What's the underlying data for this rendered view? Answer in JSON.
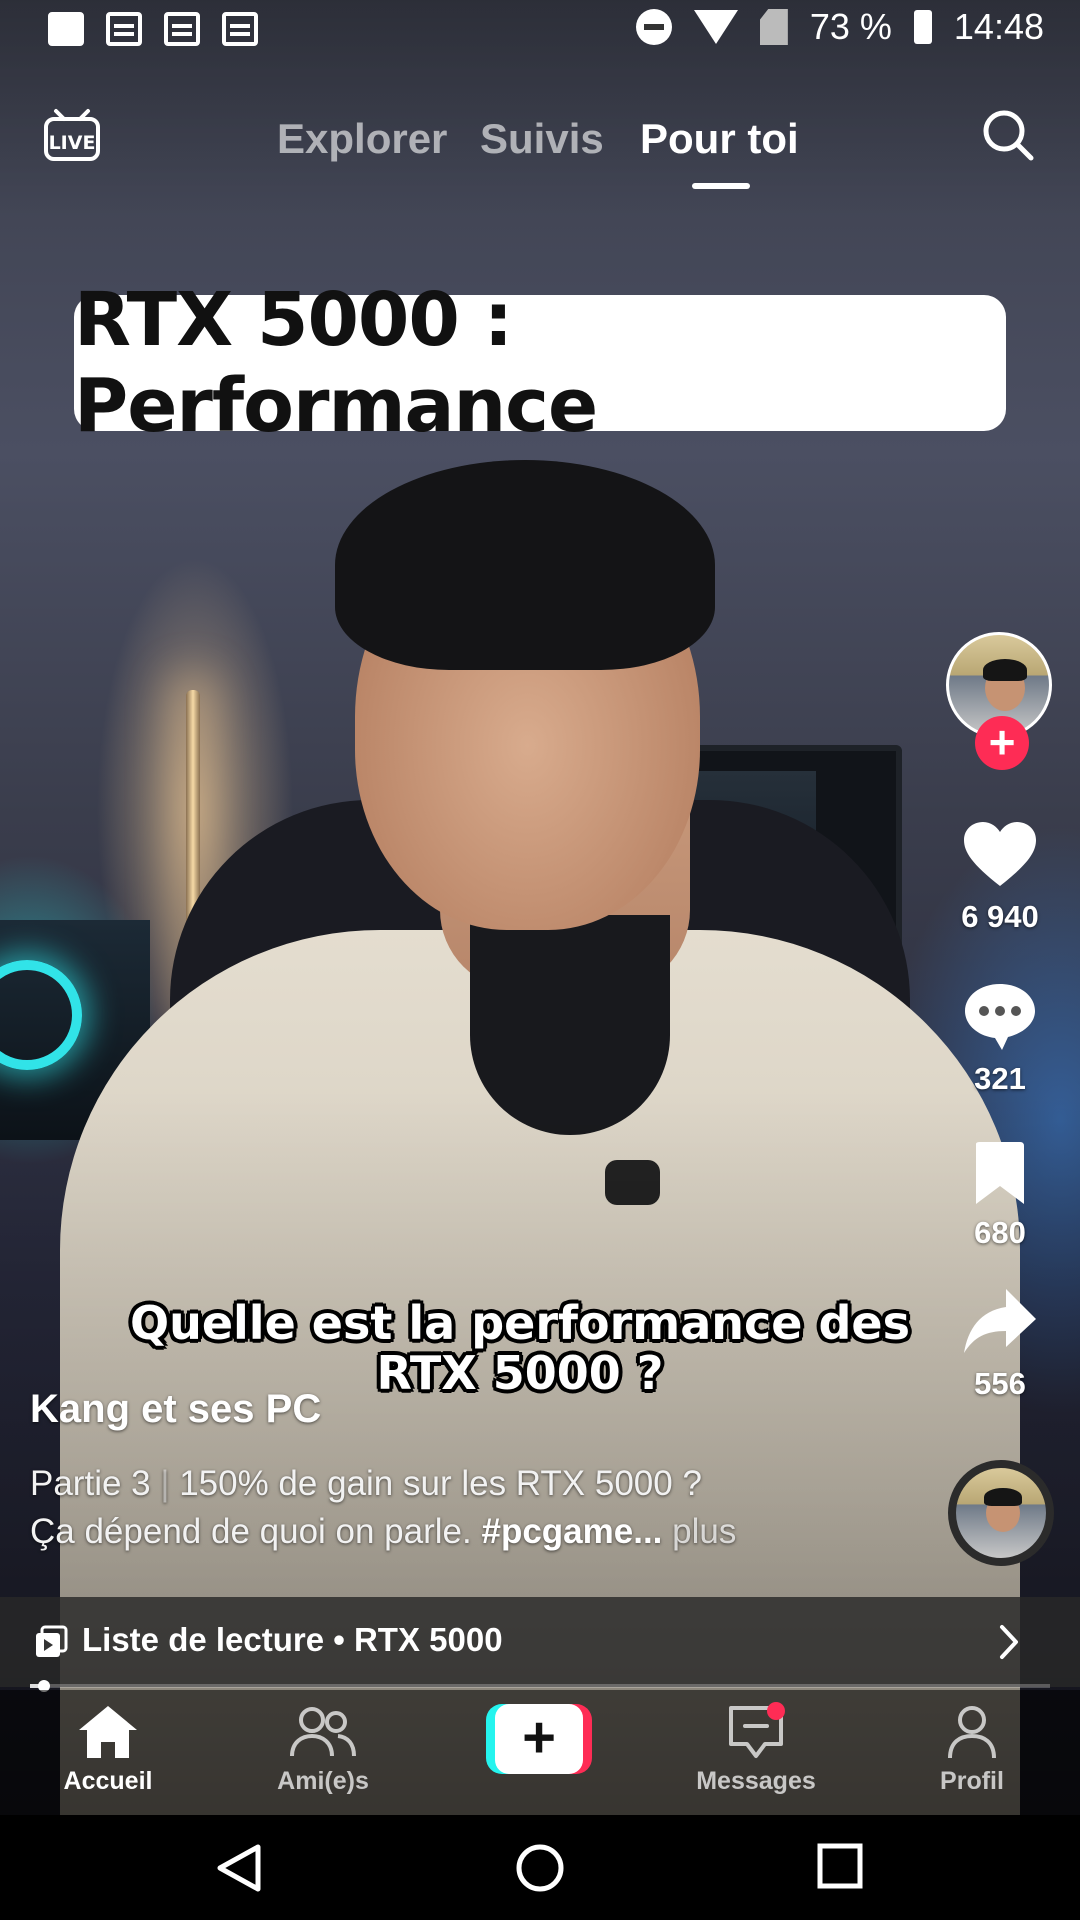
{
  "status_bar": {
    "battery": "73 %",
    "time": "14:48",
    "left_icons": [
      "gallery-icon",
      "news-icon",
      "news-icon",
      "news-icon"
    ],
    "right_icons": [
      "do-not-disturb-icon",
      "wifi-icon",
      "no-sim-icon",
      "battery-icon"
    ]
  },
  "top_nav": {
    "live_label": "LIVE",
    "tabs": [
      {
        "label": "Explorer",
        "active": false
      },
      {
        "label": "Suivis",
        "active": false
      },
      {
        "label": "Pour toi",
        "active": true
      }
    ]
  },
  "video": {
    "title_card": "RTX 5000 : Performance",
    "caption_line1": "Quelle est la performance des",
    "caption_line2": "RTX 5000 ?"
  },
  "rail": {
    "likes": "6 940",
    "comments": "321",
    "saves": "680",
    "shares": "556"
  },
  "info": {
    "author": "Kang et ses PC",
    "desc_part": "Partie 3",
    "desc_sep": "|",
    "desc_text1": "150% de gain sur les RTX 5000 ?",
    "desc_text2": "Ça dépend de quoi on parle.",
    "desc_tag": "#pcgame...",
    "desc_more": "plus"
  },
  "playlist": {
    "label": "Liste de lecture • RTX 5000",
    "progress": 0.01
  },
  "bottom_nav": {
    "home": "Accueil",
    "friends": "Ami(e)s",
    "create": "+",
    "messages": "Messages",
    "profile": "Profil"
  },
  "colors": {
    "accent": "#fe2c55",
    "cyan": "#25f4ee"
  }
}
